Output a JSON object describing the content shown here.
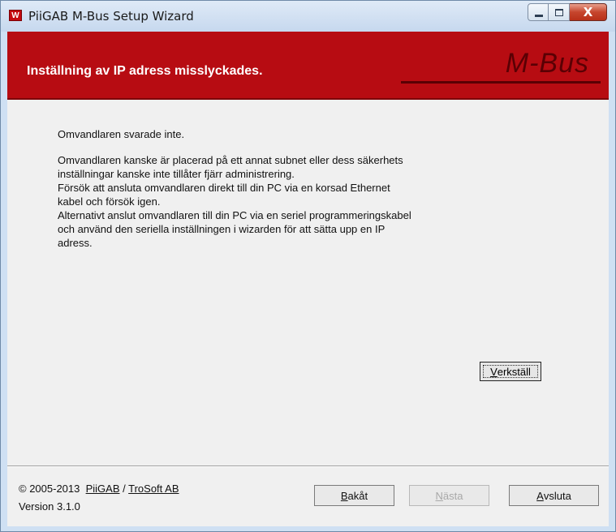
{
  "window": {
    "app_icon_letter": "W",
    "title": "PiiGAB M-Bus Setup Wizard",
    "controls": {
      "minimize": "",
      "maximize": "",
      "close": "X"
    }
  },
  "header": {
    "title": "Inställning av IP adress misslyckades.",
    "logo": "M-Bus"
  },
  "message": {
    "line1": "Omvandlaren svarade inte.",
    "paragraph": [
      "Omvandlaren kanske är placerad på ett annat subnet eller dess säkerhets",
      "inställningar kanske inte tillåter fjärr administrering.",
      "Försök att ansluta omvandlaren direkt till din PC via en korsad Ethernet",
      "kabel och försök igen.",
      "Alternativt anslut omvandlaren till din PC via en seriel programmeringskabel",
      "och använd den seriella inställningen i wizarden för att sätta upp en IP",
      "adress."
    ]
  },
  "apply_button": {
    "mnemonic": "V",
    "rest": "erkställ"
  },
  "footer": {
    "copyright": "© 2005-2013",
    "link1": "PiiGAB",
    "sep": "/",
    "link2": "TroSoft AB",
    "version": "Version 3.1.0"
  },
  "buttons": {
    "back": {
      "mnemonic": "B",
      "rest": "akåt"
    },
    "next": {
      "mnemonic": "N",
      "rest": "ästa",
      "disabled": true
    },
    "exit": {
      "mnemonic": "A",
      "rest": "vsluta"
    }
  }
}
